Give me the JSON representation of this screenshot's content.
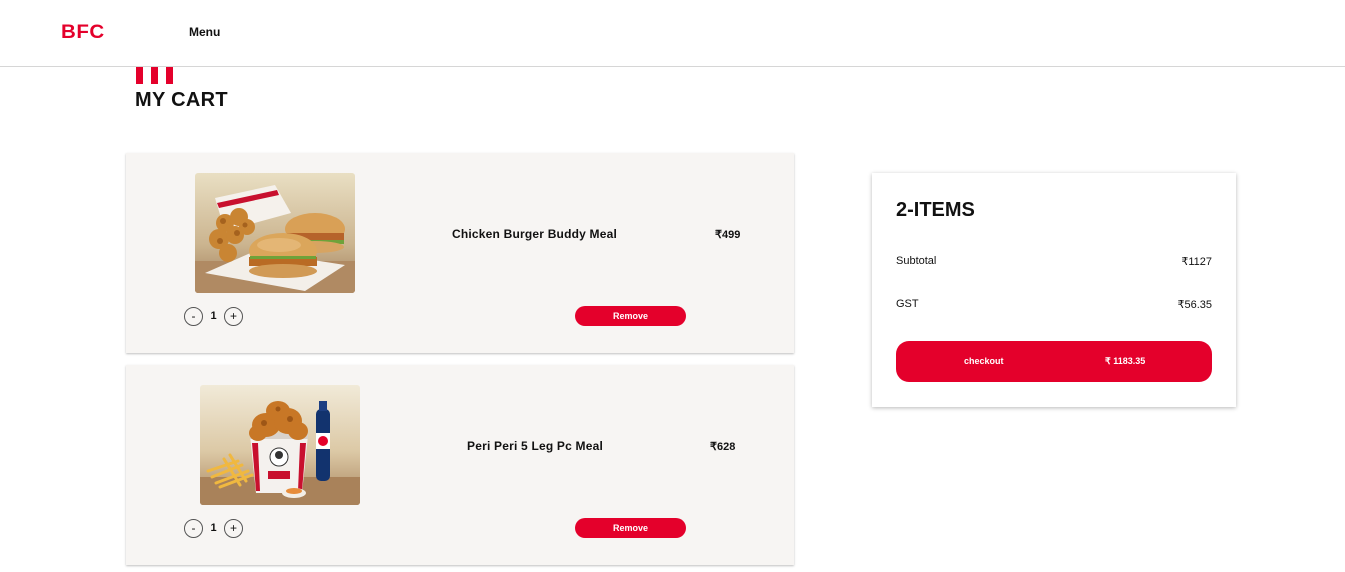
{
  "header": {
    "logo_text": "BFC",
    "nav_menu_label": "Menu"
  },
  "page": {
    "title": "MY CART"
  },
  "cart": {
    "items": [
      {
        "name": "Chicken Burger Buddy Meal",
        "price": "₹499",
        "quantity": "1",
        "decrement_label": "-",
        "increment_label": "+",
        "remove_label": "Remove"
      },
      {
        "name": "Peri Peri 5 Leg Pc Meal",
        "price": "₹628",
        "quantity": "1",
        "decrement_label": "-",
        "increment_label": "+",
        "remove_label": "Remove"
      }
    ]
  },
  "summary": {
    "title": "2-ITEMS",
    "subtotal_label": "Subtotal",
    "subtotal_value": "₹1127",
    "gst_label": "GST",
    "gst_value": "₹56.35",
    "checkout_label": "checkout",
    "checkout_amount": "₹ 1183.35"
  },
  "colors": {
    "brand_red": "#e4002b",
    "card_background": "#f7f5f3"
  }
}
